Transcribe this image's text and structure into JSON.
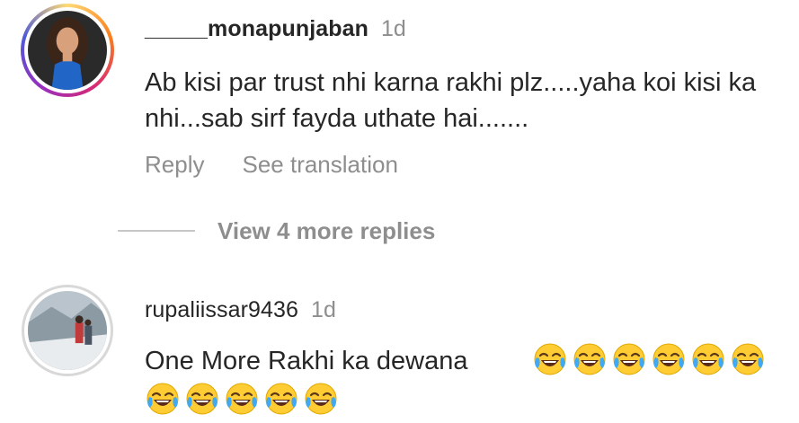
{
  "comments": [
    {
      "username": "_____monapunjaban",
      "time": "1d",
      "text": "Ab kisi par trust nhi karna rakhi plz.....yaha koi kisi ka nhi...sab sirf fayda uthate hai.......",
      "actions": {
        "reply": "Reply",
        "translate": "See translation"
      },
      "view_more": "View 4 more replies"
    },
    {
      "username": "rupaliissar9436",
      "time": "1d",
      "text": "One More Rakhi ka dewana",
      "emoji_name": "face-with-tears-of-joy",
      "emoji_count_line1": 6,
      "emoji_count_line2": 5
    }
  ],
  "colors": {
    "text_primary": "#262626",
    "text_secondary": "#8e8e8e",
    "divider": "#c7c7c7"
  }
}
